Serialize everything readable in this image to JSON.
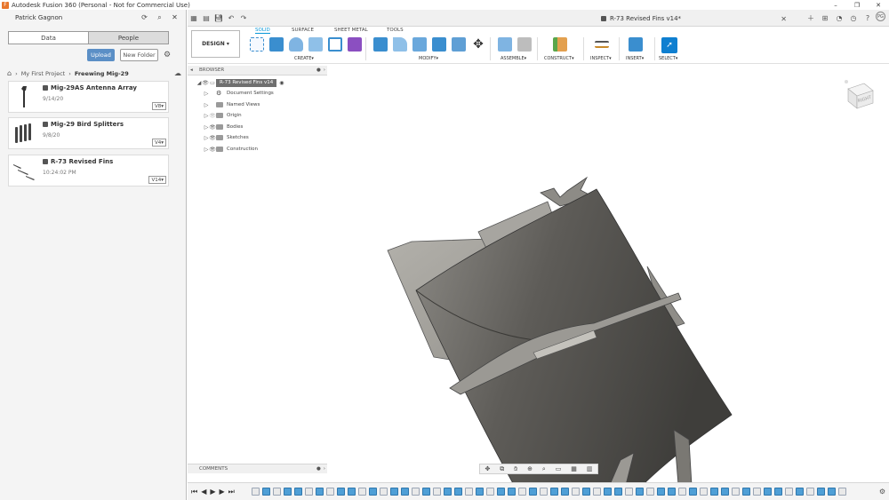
{
  "window": {
    "title": "Autodesk Fusion 360 (Personal - Not for Commercial Use)",
    "controls": [
      "–",
      "❐",
      "✕"
    ]
  },
  "left_panel": {
    "user": "Patrick Gagnon",
    "tabs": [
      "Data",
      "People"
    ],
    "upload_label": "Upload",
    "new_folder_label": "New Folder",
    "breadcrumb": [
      "My First Project",
      "Freewing Mig-29"
    ],
    "files": [
      {
        "name": "Mig-29AS Antenna Array",
        "date": "9/14/20",
        "version": "V8"
      },
      {
        "name": "Mig-29 Bird Splitters",
        "date": "9/8/20",
        "version": "V4"
      },
      {
        "name": "R-73 Revised Fins",
        "date": "10:24:02 PM",
        "version": "V14"
      }
    ]
  },
  "document": {
    "tab_title": "R-73 Revised Fins v14*"
  },
  "toolbar": {
    "workspace": "DESIGN",
    "tabs": [
      "SOLID",
      "SURFACE",
      "SHEET METAL",
      "TOOLS"
    ],
    "active_tab": "SOLID",
    "groups": [
      "CREATE",
      "MODIFY",
      "ASSEMBLE",
      "CONSTRUCT",
      "INSPECT",
      "INSERT",
      "SELECT"
    ]
  },
  "browser": {
    "title": "BROWSER",
    "root": "R-73 Revised Fins v14",
    "items": [
      "Document Settings",
      "Named Views",
      "Origin",
      "Bodies",
      "Sketches",
      "Construction"
    ]
  },
  "viewcube": {
    "face": "RIGHT"
  },
  "comments": {
    "title": "COMMENTS"
  },
  "colors": {
    "accent": "#0696d7",
    "upload_button": "#5b8fc6",
    "model_dark": "#5c5a56",
    "model_light": "#a9a7a1"
  }
}
